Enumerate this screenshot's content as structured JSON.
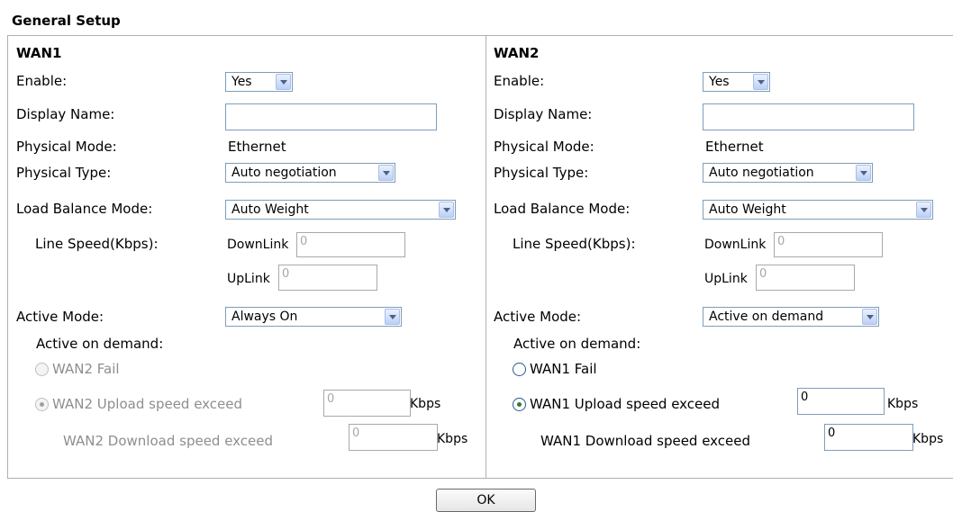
{
  "heading": "General Setup",
  "wan1": {
    "title": "WAN1",
    "enable_label": "Enable:",
    "enable_value": "Yes",
    "display_name_label": "Display Name:",
    "display_name_value": "",
    "physical_mode_label": "Physical Mode:",
    "physical_mode_value": "Ethernet",
    "physical_type_label": "Physical Type:",
    "physical_type_value": "Auto negotiation",
    "load_balance_label": "Load Balance Mode:",
    "load_balance_value": "Auto Weight",
    "line_speed_label": "Line Speed(Kbps):",
    "downlink_label": "DownLink",
    "downlink_value": "0",
    "uplink_label": "UpLink",
    "uplink_value": "0",
    "active_mode_label": "Active Mode:",
    "active_mode_value": "Always On",
    "active_on_demand_label": "Active on demand:",
    "fail_label": "WAN2 Fail",
    "upload_label": "WAN2 Upload speed exceed",
    "upload_value": "0",
    "download_label": "WAN2 Download speed exceed",
    "download_value": "0",
    "kbps": "Kbps"
  },
  "wan2": {
    "title": "WAN2",
    "enable_label": "Enable:",
    "enable_value": "Yes",
    "display_name_label": "Display Name:",
    "display_name_value": "",
    "physical_mode_label": "Physical Mode:",
    "physical_mode_value": "Ethernet",
    "physical_type_label": "Physical Type:",
    "physical_type_value": "Auto negotiation",
    "load_balance_label": "Load Balance Mode:",
    "load_balance_value": "Auto Weight",
    "line_speed_label": "Line Speed(Kbps):",
    "downlink_label": "DownLink",
    "downlink_value": "0",
    "uplink_label": "UpLink",
    "uplink_value": "0",
    "active_mode_label": "Active Mode:",
    "active_mode_value": "Active on demand",
    "active_on_demand_label": "Active on demand:",
    "fail_label": "WAN1 Fail",
    "upload_label": "WAN1 Upload speed exceed",
    "upload_value": "0",
    "download_label": "WAN1 Download speed exceed",
    "download_value": "0",
    "kbps": "Kbps"
  },
  "ok_label": "OK"
}
